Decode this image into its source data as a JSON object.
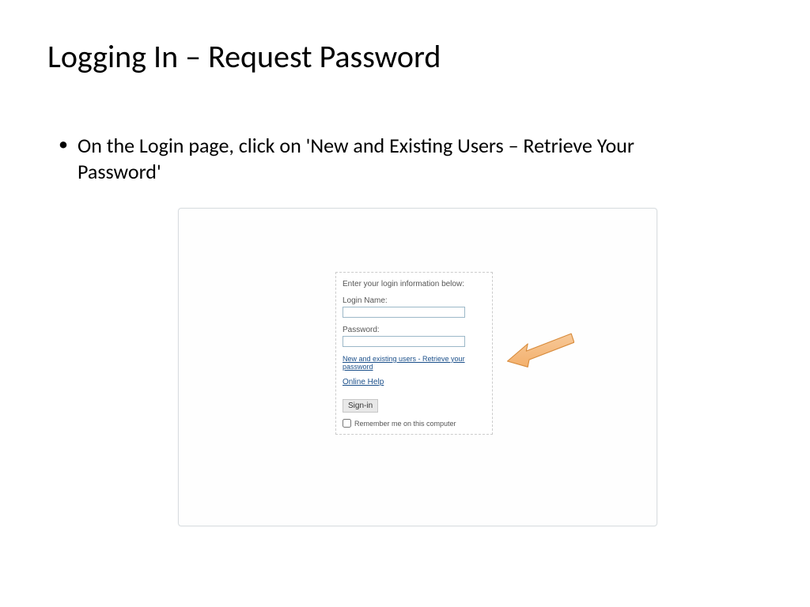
{
  "slide": {
    "title": "Logging In – Request Password",
    "bullet": "On the Login page, click on 'New and Existing Users – Retrieve Your Password'"
  },
  "login": {
    "instruction": "Enter your login information below:",
    "username_label": "Login Name:",
    "username_value": "",
    "password_label": "Password:",
    "password_value": "",
    "retrieve_link": "New and existing users - Retrieve your password",
    "help_link": "Online Help",
    "signin_label": "Sign-in",
    "remember_label": "Remember me on this computer"
  }
}
